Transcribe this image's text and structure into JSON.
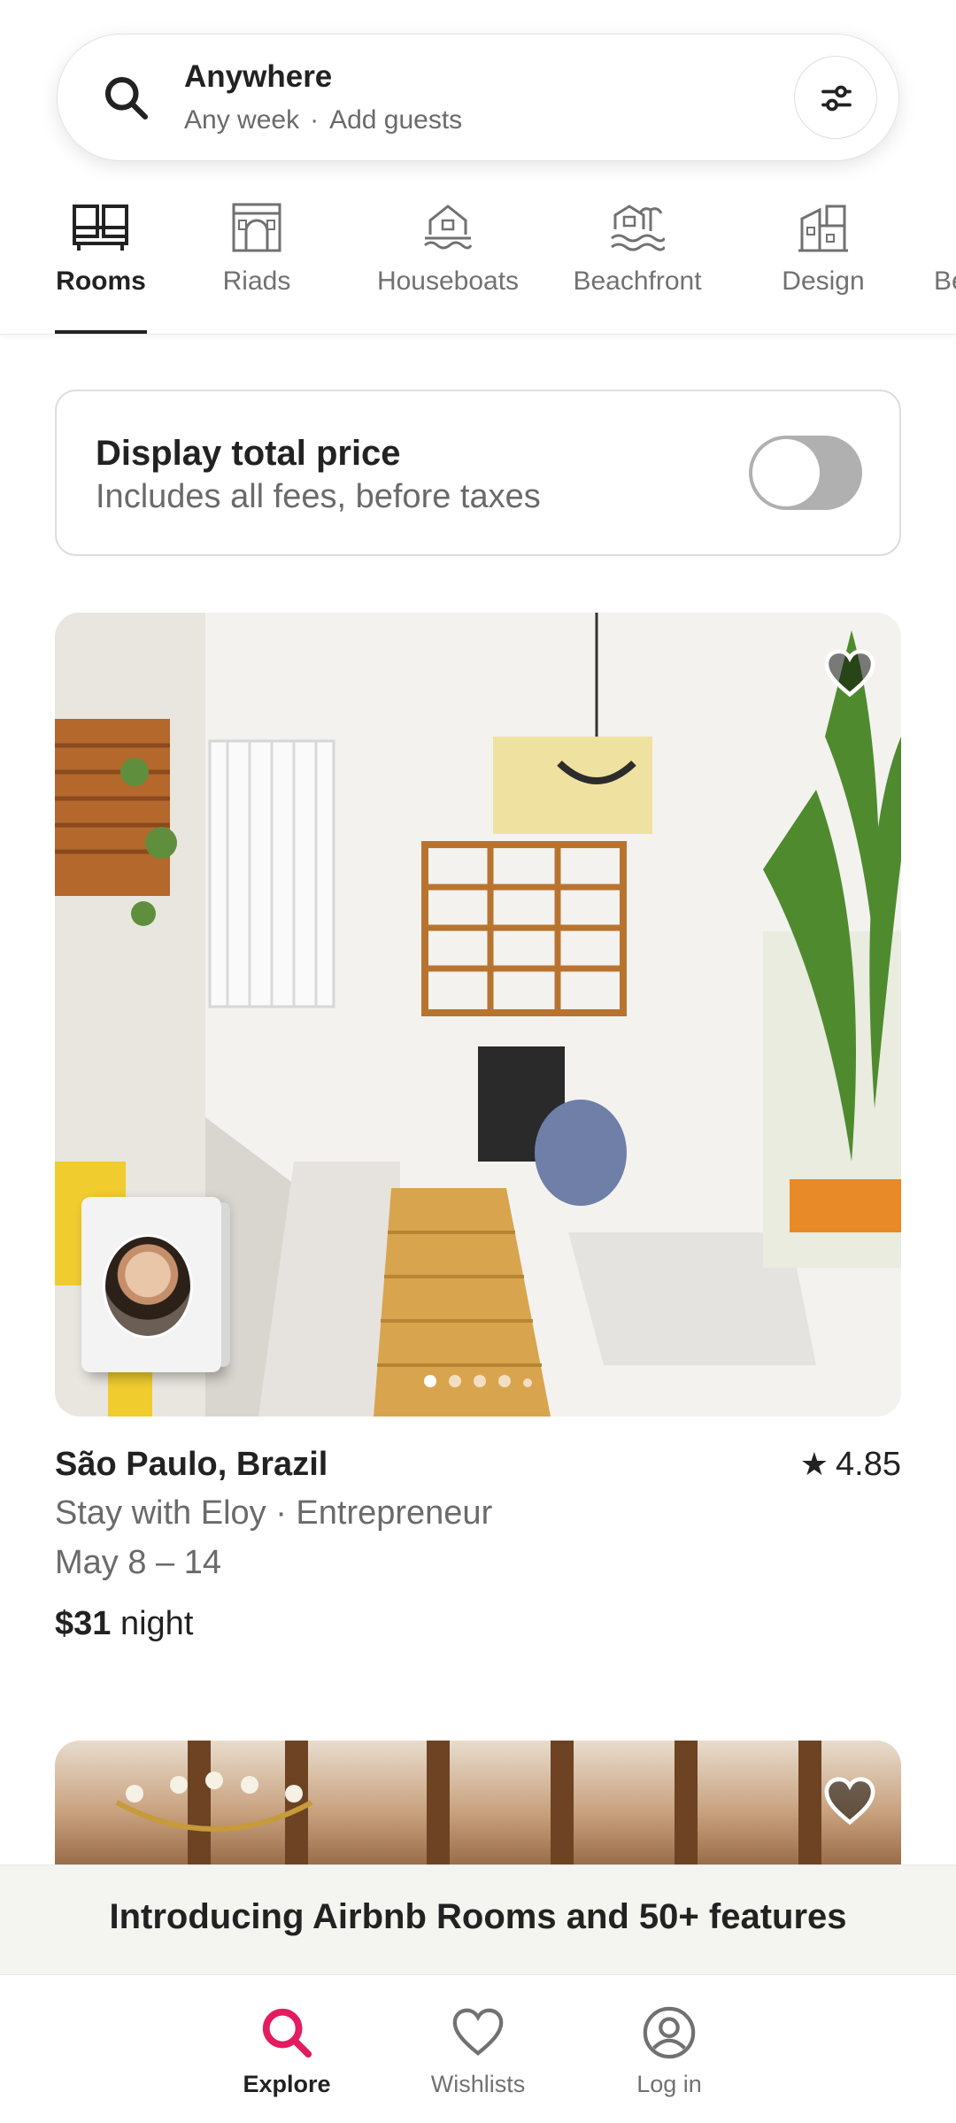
{
  "search": {
    "title": "Anywhere",
    "week": "Any week",
    "separator": "·",
    "guests": "Add guests"
  },
  "categories": [
    {
      "label": "Rooms",
      "icon": "rooms-icon",
      "active": true
    },
    {
      "label": "Riads",
      "icon": "riad-icon"
    },
    {
      "label": "Houseboats",
      "icon": "houseboat-icon"
    },
    {
      "label": "Beachfront",
      "icon": "beachfront-icon"
    },
    {
      "label": "Design",
      "icon": "design-icon"
    },
    {
      "label": "Be"
    }
  ],
  "price_toggle": {
    "title": "Display total price",
    "subtitle": "Includes all fees, before taxes",
    "enabled": false
  },
  "listing": {
    "location": "São Paulo, Brazil",
    "rating": "4.85",
    "host": "Stay with Eloy · Entrepreneur",
    "dates": "May 8 – 14",
    "price": "$31",
    "price_unit": "night",
    "photo_count": 5,
    "active_photo": 1
  },
  "banner": {
    "text": "Introducing Airbnb Rooms and 50+ features"
  },
  "nav": [
    {
      "label": "Explore",
      "icon": "search-icon",
      "active": true
    },
    {
      "label": "Wishlists",
      "icon": "heart-icon"
    },
    {
      "label": "Log in",
      "icon": "profile-icon"
    }
  ],
  "colors": {
    "brand": "#E31C5F",
    "text": "#222222",
    "muted": "#6A6A6A"
  }
}
